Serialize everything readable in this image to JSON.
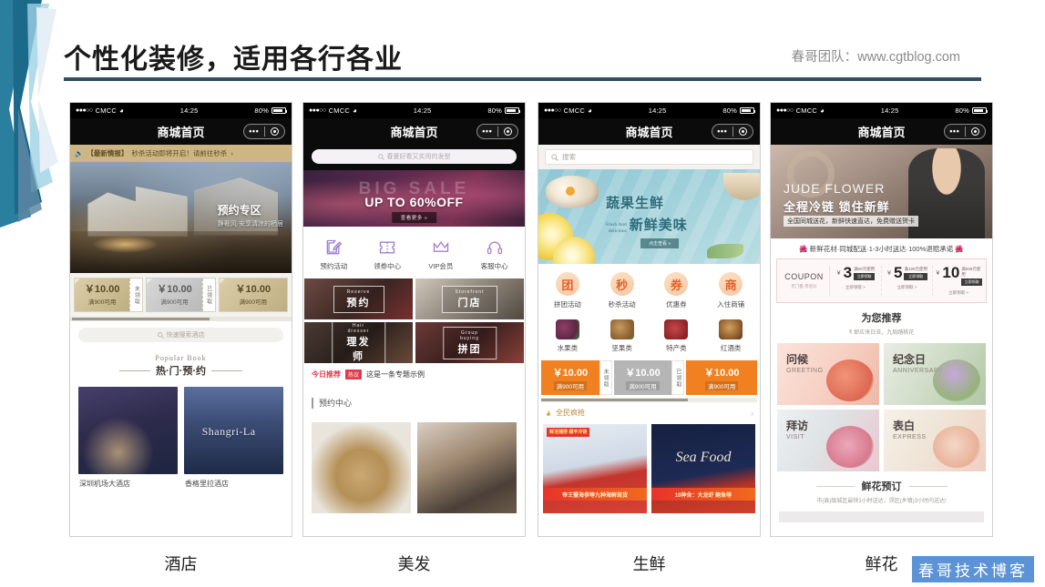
{
  "header": {
    "title": "个性化装修，适用各行各业",
    "brand": "春哥团队：www.cgtblog.com"
  },
  "watermark": "春哥技术博客",
  "statusbar": {
    "dots": "●●●○○",
    "carrier": "CMCC",
    "wifi": "≈",
    "time": "14:25",
    "battery_pct": "80%"
  },
  "navbar": {
    "title": "商城首页",
    "dots": "•••"
  },
  "phones": [
    {
      "caption": "酒店",
      "notice": {
        "horn": "🔊",
        "tag": "【最新情报】",
        "text": "秒杀活动即将开启！请前往秒杀",
        "arrow": "›"
      },
      "banner": {
        "title": "预约专区",
        "subtitle": "静奢风·安享清凉的栖居"
      },
      "coupons": [
        {
          "amount": "￥10.00",
          "cond": "满900可用",
          "state": "未领取"
        },
        {
          "amount": "￥10.00",
          "cond": "满900可用",
          "state": "已领取"
        },
        {
          "amount": "￥10.00",
          "cond": "满900可用",
          "state": ""
        }
      ],
      "search_placeholder": "快速搜索酒店",
      "section": {
        "en": "Popular Book",
        "cn": "热·门·预·约"
      },
      "cards": [
        {
          "caption": "深圳机场大酒店"
        },
        {
          "caption": "香格里拉酒店",
          "logo": "Shangri-La"
        }
      ]
    },
    {
      "caption": "美发",
      "search_placeholder": "春夏好看又实用的发型",
      "banner": {
        "bigsale": "BIG SALE",
        "headline": "UP TO 60%OFF",
        "button": "查看更多 »"
      },
      "icons": [
        {
          "name": "预约活动",
          "glyph": "edit"
        },
        {
          "name": "领券中心",
          "glyph": "ticket"
        },
        {
          "name": "VIP会员",
          "glyph": "crown"
        },
        {
          "name": "客服中心",
          "glyph": "headset"
        }
      ],
      "tiles": [
        {
          "en": "Reserve",
          "cn": "预约"
        },
        {
          "en": "Storefront",
          "cn": "门店"
        },
        {
          "en": "Hair dresser",
          "cn": "理发师"
        },
        {
          "en": "Group buying",
          "cn": "拼团"
        }
      ],
      "news": {
        "label": "今日推荐",
        "badge": "热议",
        "text": "这是一条专题示例"
      },
      "section_title": "预约中心"
    },
    {
      "caption": "生鲜",
      "search_placeholder": "搜索",
      "banner": {
        "line1": "蔬果生鲜",
        "en1": "Fresh And",
        "en2": "delicious",
        "line2": "新鲜美味",
        "pill": "点击查看 »"
      },
      "round_icons": [
        {
          "char": "团",
          "label": "拼团活动"
        },
        {
          "char": "秒",
          "label": "秒杀活动"
        },
        {
          "char": "券",
          "label": "优惠券"
        },
        {
          "char": "商",
          "label": "入住商铺"
        }
      ],
      "categories": [
        {
          "label": "水果类"
        },
        {
          "label": "坚果类"
        },
        {
          "label": "特产类"
        },
        {
          "label": "红酒类"
        }
      ],
      "coupons": [
        {
          "amount": "￥10.00",
          "cond": "满900可用",
          "state": "未领取"
        },
        {
          "amount": "￥10.00",
          "cond": "满900可用",
          "state": "已领取"
        },
        {
          "amount": "￥10.00",
          "cond": "满900可用",
          "state": ""
        }
      ],
      "row_title": "全民疯抢",
      "row_arrow": "›",
      "products": [
        {
          "sticker": "鲜活捕捞\n顺丰冷链",
          "ribbon": "帝王蟹海参等九种海鲜现货"
        },
        {
          "seafood": "Sea Food",
          "ribbon": "10种含：大龙虾 鲍鱼等"
        }
      ]
    },
    {
      "caption": "鲜花",
      "banner": {
        "title": "JUDE FLOWER",
        "subtitle": "全程冷链 锁住新鲜",
        "desc": "全国同城送花，新鲜快速直达，免费赠送贺卡"
      },
      "notice": "新鲜花材·同城配送·1-3小时送达·100%退赔承诺",
      "coupon_card": {
        "label": "COUPON",
        "sub": "无门槛·券后价",
        "items": [
          {
            "yen": "￥",
            "num": "3",
            "cond": "满99元使用",
            "btn": "立即领取",
            "foot": "立即领取 >"
          },
          {
            "yen": "￥",
            "num": "5",
            "cond": "满199元使用",
            "btn": "立即领取",
            "foot": "立即领取 >"
          },
          {
            "yen": "￥",
            "num": "10",
            "cond": "满599元使用",
            "btn": "立即领取",
            "foot": "立即领取 >"
          }
        ]
      },
      "recommend": {
        "title": "为您推荐",
        "sub": "₹ 即应来日去，九局踏桃花"
      },
      "tiles": [
        {
          "cn": "问候",
          "en": "GREETING"
        },
        {
          "cn": "纪念日",
          "en": "ANNIVERSARY"
        },
        {
          "cn": "拜访",
          "en": "VISIT"
        },
        {
          "cn": "表白",
          "en": "EXPRESS"
        }
      ],
      "booking": {
        "title": "鲜花预订",
        "sub": "市(县)级城区最快1小时送达，郊区(乡镇)3小时内送达!"
      }
    }
  ]
}
